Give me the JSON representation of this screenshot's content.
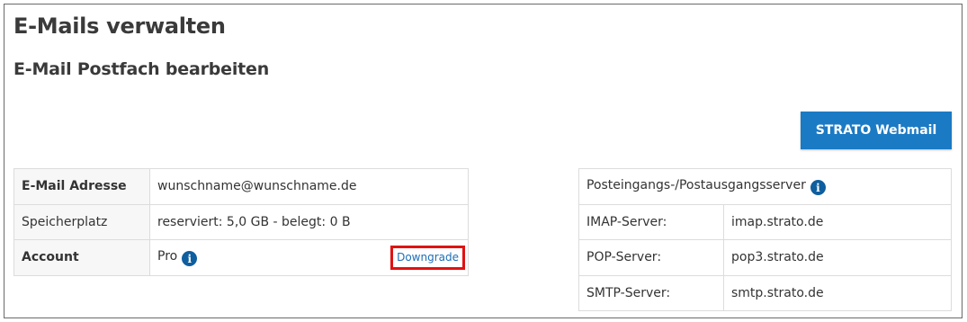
{
  "header": {
    "page_title": "E-Mails verwalten",
    "section_title": "E-Mail Postfach bearbeiten"
  },
  "actions": {
    "webmail_button": "STRATO Webmail"
  },
  "mailbox": {
    "rows": [
      {
        "label": "E-Mail Adresse",
        "value": "wunschname@wunschname.de"
      },
      {
        "label": "Speicherplatz",
        "value": "reserviert: 5,0 GB - belegt: 0 B"
      },
      {
        "label": "Account",
        "value": "Pro",
        "action": "Downgrade"
      }
    ]
  },
  "servers": {
    "heading": "Posteingangs-/Postausgangsserver",
    "rows": [
      {
        "label": "IMAP-Server:",
        "value": "imap.strato.de"
      },
      {
        "label": "POP-Server:",
        "value": "pop3.strato.de"
      },
      {
        "label": "SMTP-Server:",
        "value": "smtp.strato.de"
      }
    ]
  },
  "icons": {
    "info_glyph": "i",
    "info_icon_name": "info-icon"
  },
  "colors": {
    "primary_button": "#1b7ac4",
    "info_icon": "#0f5e9e",
    "highlight_box": "#e01212",
    "link": "#1d6fb8"
  }
}
